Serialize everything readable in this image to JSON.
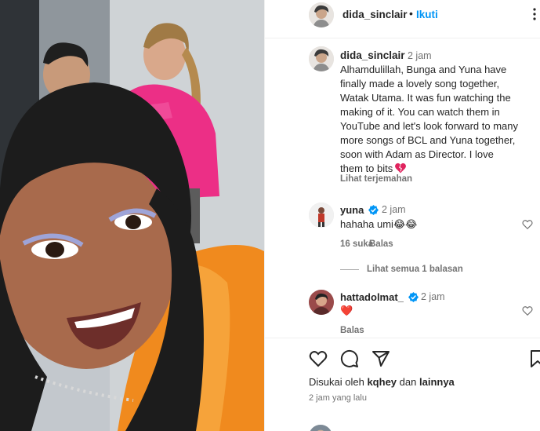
{
  "header": {
    "username": "dida_sinclair",
    "dot": "•",
    "follow_label": "Ikuti"
  },
  "caption": {
    "username": "dida_sinclair",
    "time": "2 jam",
    "text": "Alhamdulillah, Bunga and Yuna have\nfinally made a lovely song together,\nWatak Utama. It was fun watching the\nmaking of it. You can watch them in\nYouTube and let's look forward to many\nmore songs of BCL and Yuna together,\nsoon with Adam as Director. I love\nthem to bits",
    "translate_label": "Lihat terjemahan"
  },
  "comments": [
    {
      "username": "yuna",
      "time": "2 jam",
      "text": "hahaha umi😂😂",
      "likes": "16 suka",
      "reply_label": "Balas",
      "view_replies": "Lihat semua 1 balasan"
    },
    {
      "username": "hattadolmat_",
      "time": "2 jam",
      "text": "❤️",
      "reply_label": "Balas"
    }
  ],
  "footer": {
    "liked_prefix": "Disukai oleh",
    "liked_user": "kqhey",
    "liked_mid": "dan",
    "liked_others": "lainnya",
    "time": "2 jam yang lalu"
  },
  "colors": {
    "accent": "#0095f6",
    "verified": "#0095f6",
    "heart_red": "#e0245e",
    "text": "#262626",
    "muted": "#737373"
  },
  "icons": [
    "more-icon",
    "heart-icon",
    "comment-icon",
    "share-icon",
    "bookmark-icon",
    "verified-icon"
  ]
}
